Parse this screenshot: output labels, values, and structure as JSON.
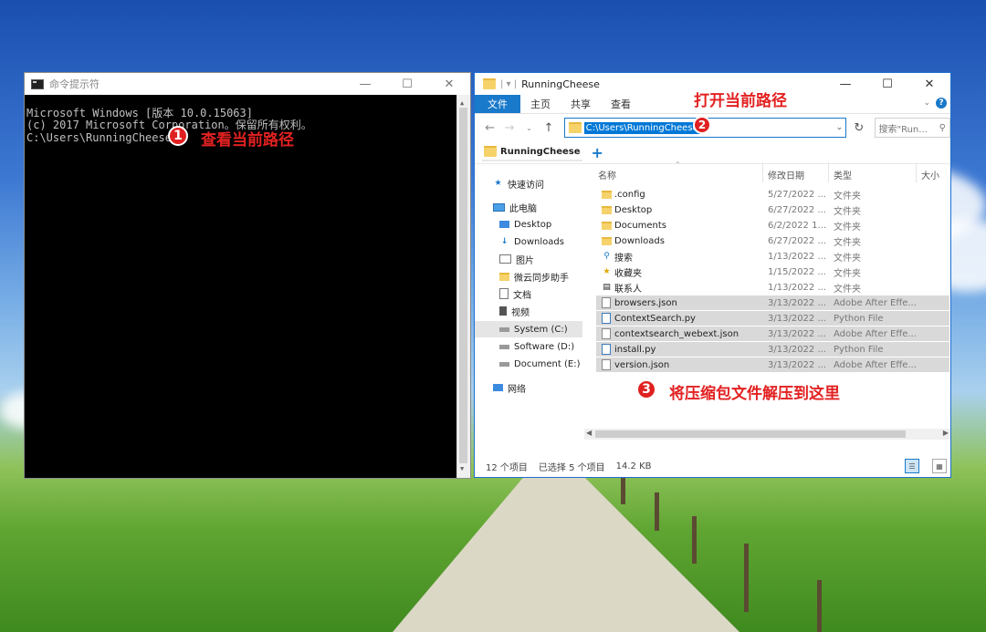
{
  "cmd": {
    "title": "命令提示符",
    "buttons": {
      "minimize": "—",
      "maximize": "☐",
      "close": "✕"
    },
    "lines": [
      "Microsoft Windows [版本 10.0.15063]",
      "(c) 2017 Microsoft Corporation。保留所有权利。",
      "",
      "C:\\Users\\RunningCheese>"
    ]
  },
  "annotations": {
    "a1": {
      "num": "1",
      "text": "查看当前路径"
    },
    "a2": {
      "num": "2",
      "text": "打开当前路径"
    },
    "a3": {
      "num": "3",
      "text": "将压缩包文件解压到这里"
    }
  },
  "explorer": {
    "title": "RunningCheese",
    "quick_access_symbol": "| ▾ |",
    "buttons": {
      "minimize": "—",
      "maximize": "☐",
      "close": "✕"
    },
    "ribbon_tabs": [
      "文件",
      "主页",
      "共享",
      "查看"
    ],
    "address": "C:\\Users\\RunningCheese",
    "search_placeholder": "搜索\"Run...",
    "folder_tab": "RunningCheese",
    "nav_items": [
      {
        "label": "快速访问",
        "icon": "star-icon"
      },
      {
        "label": "此电脑",
        "icon": "computer-icon"
      },
      {
        "label": "Desktop",
        "icon": "desktop-icon"
      },
      {
        "label": "Downloads",
        "icon": "download-icon"
      },
      {
        "label": "图片",
        "icon": "pictures-icon"
      },
      {
        "label": "微云同步助手",
        "icon": "folder-icon"
      },
      {
        "label": "文档",
        "icon": "documents-icon"
      },
      {
        "label": "视频",
        "icon": "video-icon"
      },
      {
        "label": "System (C:)",
        "icon": "drive-icon"
      },
      {
        "label": "Software (D:)",
        "icon": "drive-icon"
      },
      {
        "label": "Document (E:)",
        "icon": "drive-icon"
      },
      {
        "label": "网络",
        "icon": "network-icon"
      }
    ],
    "columns": [
      "名称",
      "修改日期",
      "类型",
      "大小"
    ],
    "files": [
      {
        "name": ".config",
        "date": "5/27/2022 ...",
        "type": "文件夹",
        "kind": "folder",
        "selected": false
      },
      {
        "name": "Desktop",
        "date": "6/27/2022 ...",
        "type": "文件夹",
        "kind": "folder",
        "selected": false
      },
      {
        "name": "Documents",
        "date": "6/2/2022 1...",
        "type": "文件夹",
        "kind": "folder",
        "selected": false
      },
      {
        "name": "Downloads",
        "date": "6/27/2022 ...",
        "type": "文件夹",
        "kind": "folder",
        "selected": false
      },
      {
        "name": "搜索",
        "date": "1/13/2022 ...",
        "type": "文件夹",
        "kind": "search",
        "selected": false
      },
      {
        "name": "收藏夹",
        "date": "1/15/2022 ...",
        "type": "文件夹",
        "kind": "star",
        "selected": false
      },
      {
        "name": "联系人",
        "date": "1/13/2022 ...",
        "type": "文件夹",
        "kind": "contacts",
        "selected": false
      },
      {
        "name": "browsers.json",
        "date": "3/13/2022 ...",
        "type": "Adobe After Effe...",
        "kind": "file",
        "selected": true
      },
      {
        "name": "ContextSearch.py",
        "date": "3/13/2022 ...",
        "type": "Python File",
        "kind": "py",
        "selected": true
      },
      {
        "name": "contextsearch_webext.json",
        "date": "3/13/2022 ...",
        "type": "Adobe After Effe...",
        "kind": "file",
        "selected": true
      },
      {
        "name": "install.py",
        "date": "3/13/2022 ...",
        "type": "Python File",
        "kind": "py",
        "selected": true
      },
      {
        "name": "version.json",
        "date": "3/13/2022 ...",
        "type": "Adobe After Effe...",
        "kind": "file",
        "selected": true
      }
    ],
    "status": {
      "count": "12 个项目",
      "selected": "已选择 5 个项目",
      "size": "14.2 KB"
    }
  }
}
